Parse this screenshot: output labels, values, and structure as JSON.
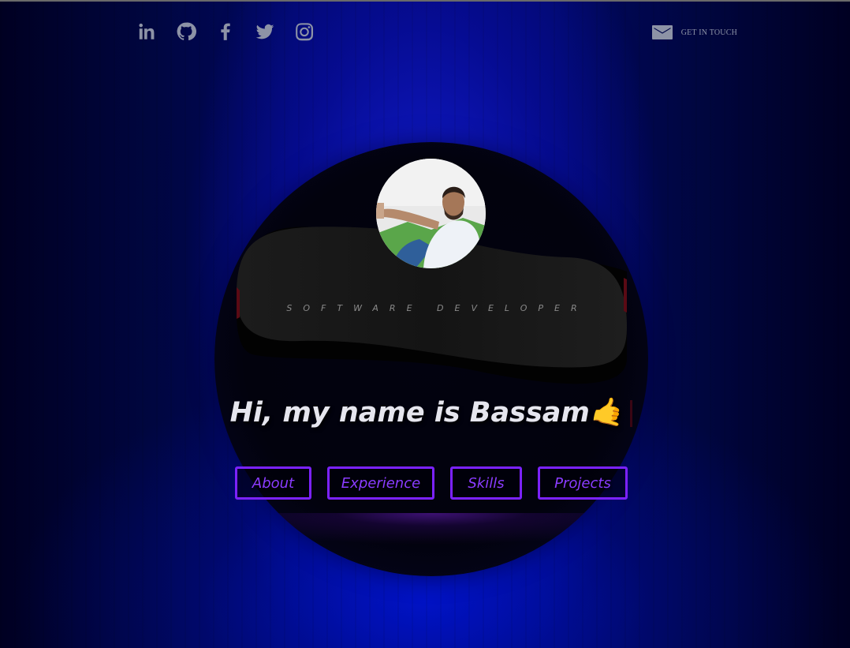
{
  "socials": [
    {
      "name": "linkedin-icon"
    },
    {
      "name": "github-icon"
    },
    {
      "name": "facebook-icon"
    },
    {
      "name": "twitter-icon"
    },
    {
      "name": "instagram-icon"
    }
  ],
  "contact": {
    "icon": "mail-icon",
    "label": "GET IN TOUCH"
  },
  "hero": {
    "tagline": "SOFTWARE DEVELOPER",
    "headline": "Hi, my name is Bassam",
    "emoji": "🤙"
  },
  "nav": {
    "about": "About",
    "experience": "Experience",
    "skills": "Skills",
    "projects": "Projects"
  },
  "colors": {
    "accent": "#7b22ff",
    "icon": "#8d93a6",
    "background": "#000a6a"
  }
}
